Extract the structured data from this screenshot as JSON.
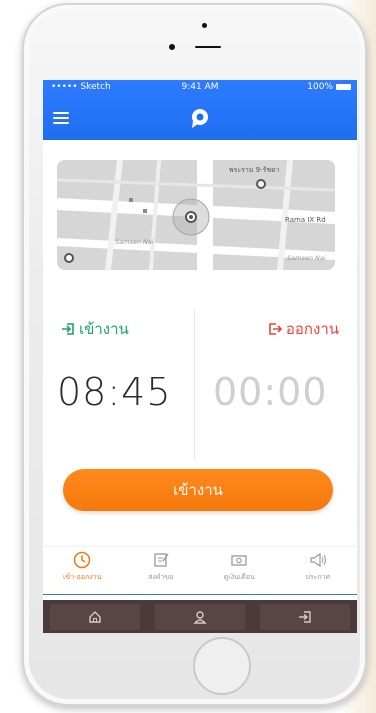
{
  "status": {
    "carrier": "••••• Sketch",
    "time": "9:41 AM",
    "battery": "100%"
  },
  "app": {
    "menu_icon": "hamburger-menu-icon",
    "logo_icon": "app-logo-icon",
    "accent_color": "#1e6ef0"
  },
  "map": {
    "labels": [
      "พระราม 9-รัชดา",
      "Rama IX Rd",
      "Samsen Nai",
      "Samsen Nai"
    ]
  },
  "attendance": {
    "checkin_label": "เข้างาน",
    "checkout_label": "ออกงาน",
    "checkin_time": "08:45",
    "checkout_time": "00:00",
    "checkin_color": "#19a66a",
    "checkout_color": "#e8453c"
  },
  "action": {
    "button_label": "เข้างาน",
    "button_color": "#f5780b"
  },
  "bottom_nav": {
    "items": [
      {
        "label": "เข้า-ออกงาน",
        "icon": "clock-icon",
        "active": true
      },
      {
        "label": "ส่งคำขอ",
        "icon": "edit-icon",
        "active": false
      },
      {
        "label": "ดูเงินเดือน",
        "icon": "money-icon",
        "active": false
      },
      {
        "label": "ประกาศ",
        "icon": "megaphone-icon",
        "active": false
      }
    ]
  },
  "dock": {
    "items": [
      {
        "icon": "home-icon"
      },
      {
        "icon": "user-icon"
      },
      {
        "icon": "logout-icon"
      }
    ]
  }
}
